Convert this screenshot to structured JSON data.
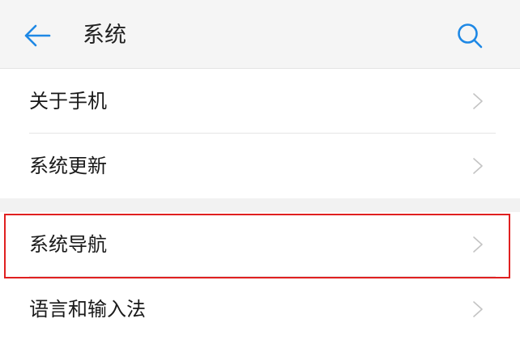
{
  "header": {
    "title": "系统",
    "back_icon": "arrow-left-icon",
    "search_icon": "search-icon",
    "accent_color": "#1e88e5"
  },
  "settings": {
    "group_1": [
      {
        "label": "关于手机",
        "icon": "chevron-right-icon"
      },
      {
        "label": "系统更新",
        "icon": "chevron-right-icon"
      }
    ],
    "group_2": [
      {
        "label": "系统导航",
        "icon": "chevron-right-icon",
        "highlighted": true
      },
      {
        "label": "语言和输入法",
        "icon": "chevron-right-icon"
      }
    ]
  },
  "colors": {
    "highlight_border": "#e02020",
    "background": "#f2f2f2",
    "card": "#ffffff"
  }
}
